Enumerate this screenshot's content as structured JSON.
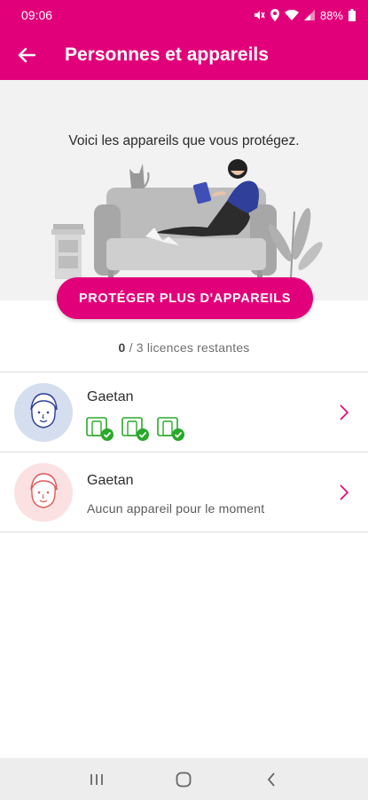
{
  "status_bar": {
    "time": "09:06",
    "battery": "88%"
  },
  "app_bar": {
    "title": "Personnes et appareils"
  },
  "hero": {
    "text": "Voici les appareils que vous protégez."
  },
  "cta": {
    "label": "PROTÉGER PLUS D'APPAREILS"
  },
  "licences": {
    "used": "0",
    "rest": " / 3 licences restantes"
  },
  "people": [
    {
      "name": "Gaetan",
      "devices": [
        "tablet-check-icon",
        "tablet-check-icon",
        "tablet-check-icon"
      ]
    },
    {
      "name": "Gaetan",
      "subtitle": "Aucun appareil pour le moment"
    }
  ],
  "colors": {
    "brand": "#e2007a",
    "check": "#2aa82a",
    "avatar1_bg": "#d5deef",
    "avatar2_bg": "#fbe1e1"
  }
}
